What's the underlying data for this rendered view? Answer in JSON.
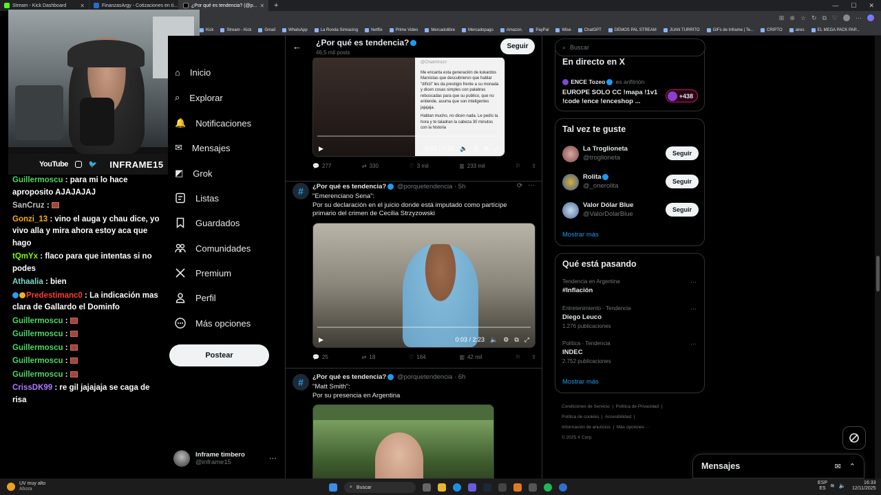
{
  "browser": {
    "tabs": [
      {
        "label": "Stream - Kick Dashboard"
      },
      {
        "label": "FinanzasArgy - Cotizaciones en ti..."
      },
      {
        "label": "¿Por qué es tendencia? (@p..."
      }
    ],
    "bookmarks": [
      "Kick",
      "Stream - Kick",
      "Gmail",
      "WhatsApp",
      "La Ronda Simracing",
      "Netflix",
      "Prime Video",
      "Mercadolibre",
      "Mercadopago",
      "Amazon.",
      "PayPal",
      "Wise",
      "ChatGPT",
      "DEMOS PAL STREAM",
      "JUAN TURRITO",
      "GIFs de Inframe | Te...",
      "CRIPTO",
      "aires",
      "EL MEGA PACK PAP..."
    ]
  },
  "webcam": {
    "footer_youtube": "YouTube",
    "footer_handle": "INFRAME15"
  },
  "chat": {
    "messages": [
      {
        "user": "Guillermoscu",
        "color": "#4cd964",
        "text": "para mi lo hace aproposito AJAJAJAJ",
        "emote": false
      },
      {
        "user": "SanCruz",
        "color": "#c0c0c0",
        "text": "",
        "emote": true
      },
      {
        "user": "Gonzi_13",
        "color": "#ffb000",
        "text": "vino el auga y chau dice, yo vivo alla y mira ahora estoy aca que hago",
        "emote": false
      },
      {
        "user": "tQmYx",
        "color": "#7cfc00",
        "text": "flaco para que intentas si no podes",
        "emote": false
      },
      {
        "user": "Athaalia",
        "color": "#7fd8c8",
        "text": "bien",
        "emote": false
      },
      {
        "user": "Predestimanc0",
        "color": "#ff3b3b",
        "text": "La indicación mas clara de Gallardo el Dominfo",
        "emote": false,
        "badges": true
      },
      {
        "user": "Guillermoscu",
        "color": "#4cd964",
        "text": "",
        "emote": true
      },
      {
        "user": "Guillermoscu",
        "color": "#4cd964",
        "text": "",
        "emote": true
      },
      {
        "user": "Guillermoscu",
        "color": "#4cd964",
        "text": "",
        "emote": true
      },
      {
        "user": "Guillermoscu",
        "color": "#4cd964",
        "text": "",
        "emote": true
      },
      {
        "user": "Guillermoscu",
        "color": "#4cd964",
        "text": "",
        "emote": true
      },
      {
        "user": "CrissDK99",
        "color": "#b07cff",
        "text": "re gil jajajaja se caga de risa",
        "emote": false
      }
    ]
  },
  "nav": {
    "items": [
      "Inicio",
      "Explorar",
      "Notificaciones",
      "Mensajes",
      "Grok",
      "Listas",
      "Guardados",
      "Comunidades",
      "Premium",
      "Perfil",
      "Más opciones"
    ],
    "post_label": "Postear",
    "account_name": "Inframe timbero",
    "account_handle": "@inframe15"
  },
  "timeline": {
    "title": "¿Por qué es tendencia?",
    "subtitle": "46,5 mil posts",
    "follow_label": "Seguir",
    "quoted_handle": "@ChadAtrazo",
    "quoted_text": "Me encanta esta generación de kukardos Marxistas que descubrieron que hablar \"difícil\" les da prestigio frente a su monada y dicen cosas simples con palabras rebuscadas para que su publico, que no entiende, asuma que son inteligentes jajajaja.",
    "quoted_text2": "Hablan mucho, no dicen nada. Le pedís la hora y te taladran la cabeza 30 minutos con la historia",
    "tweets": [
      {
        "video_time": "0:01 / 0:58",
        "stats": {
          "replies": "277",
          "reposts": "330",
          "likes": "3 mil",
          "views": "233 mil"
        }
      },
      {
        "name": "¿Por qué es tendencia?",
        "handle": "@porquetendencia",
        "time": "· 5h",
        "line1": "\"Emerenciano Sena\":",
        "line2": "Por su declaración en el juicio donde está imputado como partícipe primario del crimen de Cecilia Strzyzowski",
        "video_time": "0:03 / 2:23",
        "stats": {
          "replies": "25",
          "reposts": "18",
          "likes": "164",
          "views": "42 mil"
        }
      },
      {
        "name": "¿Por qué es tendencia?",
        "handle": "@porquetendencia",
        "time": "· 6h",
        "line1": "\"Matt Smith\":",
        "line2": "Por su presencia en Argentina"
      }
    ]
  },
  "right": {
    "search_placeholder": "Buscar",
    "live": {
      "title": "En directo en X",
      "host": "ENCE Tozeo",
      "host_role": "es anfitrión",
      "text": "EUROPE SOLO CC !mapa !1v1 !code !ence !enceshop ...",
      "count": "+438"
    },
    "suggest": {
      "title": "Tal vez te guste",
      "people": [
        {
          "name": "La Troglioneta",
          "handle": "@troglioneta",
          "verified": false
        },
        {
          "name": "Rolita",
          "handle": "@_onerolita",
          "verified": true
        },
        {
          "name": "Valor Dólar Blue",
          "handle": "@ValorDolarBlue",
          "verified": false
        }
      ],
      "follow_label": "Seguir",
      "more": "Mostrar más"
    },
    "trends": {
      "title": "Qué está pasando",
      "items": [
        {
          "context": "Tendencia en Argentina",
          "name": "#Inflación",
          "posts": ""
        },
        {
          "context": "Entretenimiento · Tendencia",
          "name": "Diego Leuco",
          "posts": "1.276 publicaciones"
        },
        {
          "context": "Política · Tendencia",
          "name": "INDEC",
          "posts": "2.752 publicaciones"
        }
      ],
      "more": "Mostrar más"
    },
    "footer": {
      "l1a": "Condiciones de Servicio",
      "l1b": "Política de Privacidad",
      "l2a": "Política de cookies",
      "l2b": "Accesibilidad",
      "l3a": "Información de anuncios",
      "l3b": "Más opciones ···",
      "copy": "© 2025 X Corp."
    },
    "messages_label": "Mensajes"
  },
  "taskbar": {
    "weather": "UV muy alto",
    "weather_sub": "Ahora",
    "search": "Buscar",
    "lang": "ESP",
    "lang2": "ES",
    "time": "16:33",
    "date": "12/11/2025"
  }
}
